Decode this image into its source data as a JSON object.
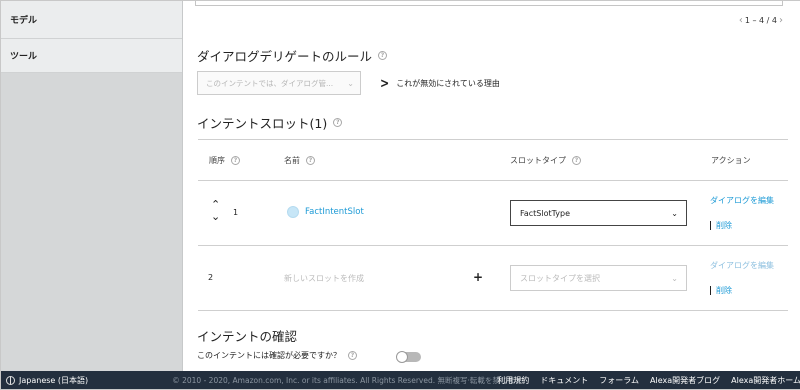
{
  "sidebar": {
    "items": [
      {
        "label": "モデル"
      },
      {
        "label": "ツール"
      }
    ]
  },
  "pager": {
    "text": "1 – 4 / 4",
    "prev": "‹",
    "next": "›"
  },
  "dialog_delegate": {
    "title": "ダイアログデリゲートのルール",
    "select_placeholder": "このインテントでは、ダイアログ管...",
    "reason_link": "これが無効にされている理由"
  },
  "intent_slots": {
    "title": "インテントスロット(1)",
    "headers": {
      "order": "順序",
      "name": "名前",
      "slot_type": "スロットタイプ",
      "actions": "アクション"
    },
    "rows": [
      {
        "order": "1",
        "name": "FactIntentSlot",
        "slot_type": "FactSlotType",
        "edit": "ダイアログを編集",
        "delete": "削除"
      }
    ],
    "new_row": {
      "order": "2",
      "name_placeholder": "新しいスロットを作成",
      "plus": "+",
      "slot_type_placeholder": "スロットタイプを選択",
      "edit": "ダイアログを編集",
      "delete": "削除"
    }
  },
  "intent_confirm": {
    "title": "インテントの確認",
    "question": "このインテントには確認が必要ですか？",
    "toggle_on": false
  },
  "footer": {
    "language": "Japanese (日本語)",
    "copyright": "© 2010 - 2020, Amazon.com, Inc. or its affiliates. All Rights Reserved. 無断複写·転載を禁じます",
    "links": [
      "利用規約",
      "ドキュメント",
      "フォーラム",
      "Alexa開発者ブログ",
      "Alexa開発者ホーム"
    ]
  },
  "colors": {
    "link": "#1c9ad6",
    "footer_bg": "#232f3e",
    "sidebar_bg": "#d5d7d8"
  },
  "icons": {
    "help": "help-circle-icon",
    "sort_up": "chevron-up-icon",
    "sort_down": "chevron-down-icon",
    "select": "chevron-down-icon",
    "reason": "chevron-right-icon",
    "lang": "globe-icon"
  }
}
